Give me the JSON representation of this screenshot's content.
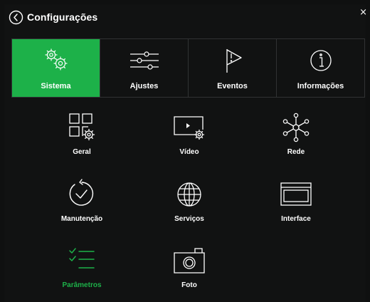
{
  "window": {
    "title": "Configurações",
    "close_glyph": "×"
  },
  "tabs": [
    {
      "label": "Sistema",
      "icon": "gears-icon",
      "active": true
    },
    {
      "label": "Ajustes",
      "icon": "sliders-icon",
      "active": false
    },
    {
      "label": "Eventos",
      "icon": "flag-icon",
      "active": false
    },
    {
      "label": "Informações",
      "icon": "info-icon",
      "active": false
    }
  ],
  "items": [
    {
      "label": "Geral",
      "icon": "general-settings-icon",
      "active": false
    },
    {
      "label": "Vídeo",
      "icon": "video-settings-icon",
      "active": false
    },
    {
      "label": "Rede",
      "icon": "network-icon",
      "active": false
    },
    {
      "label": "Manutenção",
      "icon": "maintenance-icon",
      "active": false
    },
    {
      "label": "Serviços",
      "icon": "globe-icon",
      "active": false
    },
    {
      "label": "Interface",
      "icon": "interface-icon",
      "active": false
    },
    {
      "label": "Parâmetros",
      "icon": "checklist-icon",
      "active": true
    },
    {
      "label": "Foto",
      "icon": "camera-icon",
      "active": false
    }
  ],
  "colors": {
    "accent": "#1db149",
    "background": "#111212",
    "text": "#ffffff"
  }
}
